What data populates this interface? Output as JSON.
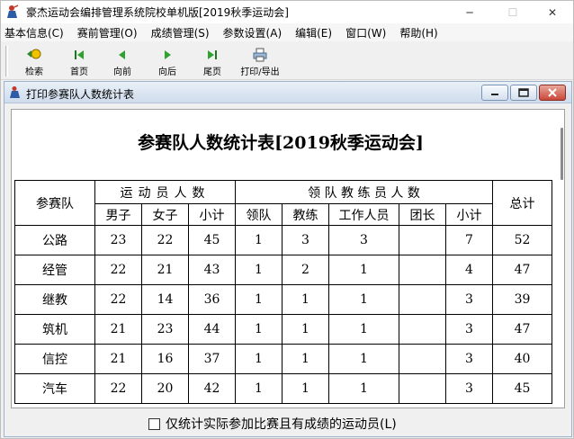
{
  "window": {
    "title": "豪杰运动会编排管理系统院校单机版[2019秋季运动会]",
    "minimize": "─",
    "maximize": "☐",
    "close": "✕"
  },
  "menu": [
    "基本信息(C)",
    "赛前管理(O)",
    "成绩管理(S)",
    "参数设置(A)",
    "编辑(E)",
    "窗口(W)",
    "帮助(H)"
  ],
  "toolbar": {
    "search": "检索",
    "first": "首页",
    "prev": "向前",
    "next": "向后",
    "last": "尾页",
    "print": "打印/导出"
  },
  "child_window": {
    "title": "打印参赛队人数统计表"
  },
  "report": {
    "title": "参赛队人数统计表[2019秋季运动会]",
    "headers": {
      "team": "参赛队",
      "athletes": "运动员人数",
      "staff": "领 队 教 练 员 人 数",
      "total": "总计",
      "male": "男子",
      "female": "女子",
      "subtotal1": "小计",
      "leader": "领队",
      "coach": "教练",
      "worker": "工作人员",
      "captain": "团长",
      "subtotal2": "小计"
    },
    "rows": [
      {
        "team": "公路",
        "male": "23",
        "female": "22",
        "sub1": "45",
        "leader": "1",
        "coach": "3",
        "worker": "3",
        "captain": "",
        "sub2": "7",
        "total": "52"
      },
      {
        "team": "经管",
        "male": "22",
        "female": "21",
        "sub1": "43",
        "leader": "1",
        "coach": "2",
        "worker": "1",
        "captain": "",
        "sub2": "4",
        "total": "47"
      },
      {
        "team": "继教",
        "male": "22",
        "female": "14",
        "sub1": "36",
        "leader": "1",
        "coach": "1",
        "worker": "1",
        "captain": "",
        "sub2": "3",
        "total": "39"
      },
      {
        "team": "筑机",
        "male": "21",
        "female": "23",
        "sub1": "44",
        "leader": "1",
        "coach": "1",
        "worker": "1",
        "captain": "",
        "sub2": "3",
        "total": "47"
      },
      {
        "team": "信控",
        "male": "21",
        "female": "16",
        "sub1": "37",
        "leader": "1",
        "coach": "1",
        "worker": "1",
        "captain": "",
        "sub2": "3",
        "total": "40"
      },
      {
        "team": "汽车",
        "male": "22",
        "female": "20",
        "sub1": "42",
        "leader": "1",
        "coach": "1",
        "worker": "1",
        "captain": "",
        "sub2": "3",
        "total": "45"
      }
    ]
  },
  "bottom": {
    "checkbox_label": "仅统计实际参加比赛且有成绩的运动员(L)",
    "checked": false
  }
}
